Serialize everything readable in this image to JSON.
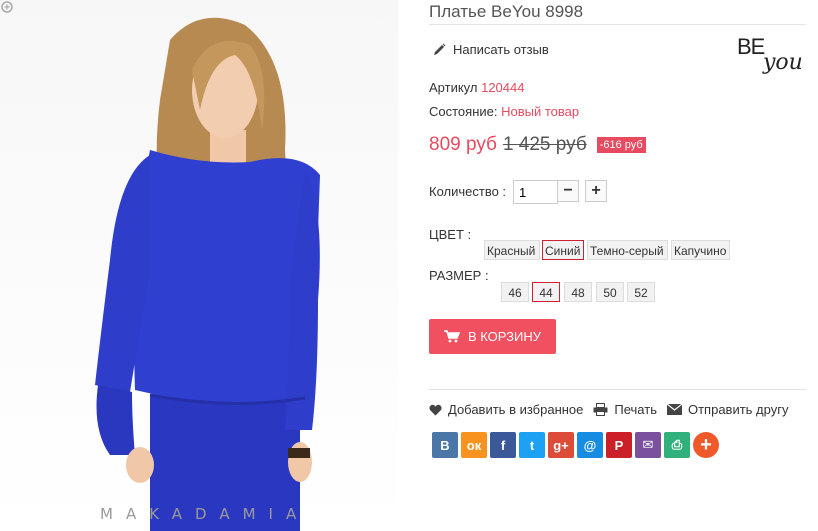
{
  "product": {
    "title": "Платье BeYou 8998",
    "write_review": "Написать отзыв",
    "sku_label": "Артикул",
    "sku_value": "120444",
    "condition_label": "Состояние:",
    "condition_value": "Новый товар",
    "price": "809 руб",
    "old_price": "1 425 руб",
    "discount": "-616 руб"
  },
  "brand": {
    "logo_top": "BE",
    "logo_bottom": "you"
  },
  "image": {
    "watermark": "MAKADAMIA"
  },
  "quantity": {
    "label": "Количество :",
    "value": "1",
    "minus": "−",
    "plus": "+"
  },
  "color": {
    "label": "ЦВЕТ :",
    "options": [
      "Красный",
      "Синий",
      "Темно-серый",
      "Капучино"
    ],
    "selected": "Синий"
  },
  "size": {
    "label": "РАЗМЕР :",
    "options": [
      "46",
      "44",
      "48",
      "50",
      "52"
    ],
    "selected": "44"
  },
  "cart_button": "В КОРЗИНУ",
  "actions": {
    "favorite": "Добавить в избранное",
    "print": "Печать",
    "send": "Отправить другу"
  },
  "social": [
    {
      "name": "vk-icon",
      "glyph": "B",
      "color": "#4a76a8"
    },
    {
      "name": "odnoklassniki-icon",
      "glyph": "ок",
      "color": "#f7931e"
    },
    {
      "name": "facebook-icon",
      "glyph": "f",
      "color": "#3b5998"
    },
    {
      "name": "twitter-icon",
      "glyph": "t",
      "color": "#1da1f2"
    },
    {
      "name": "google-plus-icon",
      "glyph": "g+",
      "color": "#dd4b39"
    },
    {
      "name": "mail-ru-icon",
      "glyph": "@",
      "color": "#168de2"
    },
    {
      "name": "pinterest-icon",
      "glyph": "P",
      "color": "#cb2027"
    },
    {
      "name": "email-icon",
      "glyph": "✉",
      "color": "#7b519d"
    },
    {
      "name": "print-icon",
      "glyph": "⎙",
      "color": "#30b07a"
    },
    {
      "name": "more-icon",
      "glyph": "+",
      "color": "#f05a2a"
    }
  ],
  "colors": {
    "accent": "#e84a5f",
    "button": "#f0505f"
  }
}
